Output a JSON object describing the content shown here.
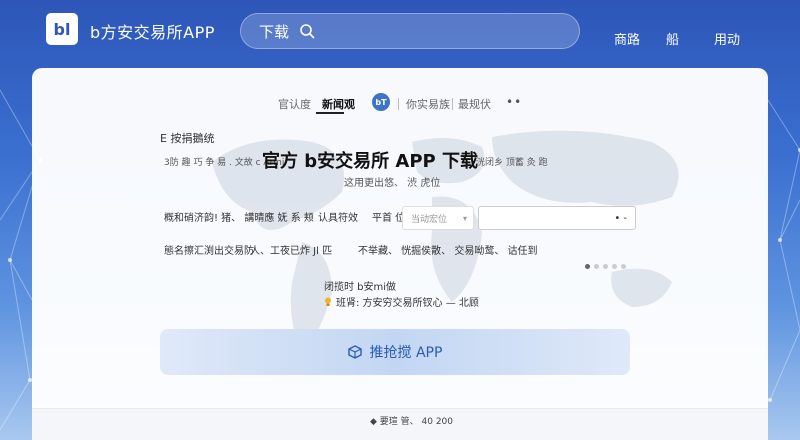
{
  "header": {
    "logo_mark": "bl",
    "app_name": "b方安交易所APP",
    "search_label": "下载",
    "search_placeholder": "",
    "nav": [
      "商路",
      "船",
      "用动"
    ]
  },
  "tabs": {
    "items": [
      "官认度",
      "新闻观",
      "你实易族",
      "最规伏"
    ],
    "active": "新闻观",
    "badge": "bT",
    "more": "••"
  },
  "content": {
    "sub_heading": "E 按捐鵝统",
    "title_left": "3防 趣 巧 争 易 . 文故 c Armi",
    "title_main": "官方 b安交易所 APP 下载",
    "title_right": "洸闭乡 顶蓄 灸 跑",
    "title_sub": "这用更出悠、 渋 虎位",
    "filter_left": "概和硝济韵! 猪、 講晴應  妩 系 颊",
    "filter_label_2": "认具符效",
    "filter_label_3": "平首  位",
    "select_value": "当动宏位",
    "input_value": "• -",
    "info_left": "態名擦汇渕出交易防",
    "info_mid": "人、工夜已炸 Jl 匹",
    "info_text": "不举藏、 恍掘侯散、 交易呦鹜、 诂任到",
    "version": "闭揽时 b安mi做",
    "hint": "班肾: 方安穷交易所钗心 — 北顾",
    "pager_count": 5,
    "pager_active": 0
  },
  "download_button": {
    "label": "推抢搅 APP",
    "icon": "cube-icon"
  },
  "footer": {
    "text": "◆ 要瑄 管、 40 200"
  },
  "colors": {
    "brand": "#2d56b8",
    "button_text": "#2a5bb3"
  }
}
